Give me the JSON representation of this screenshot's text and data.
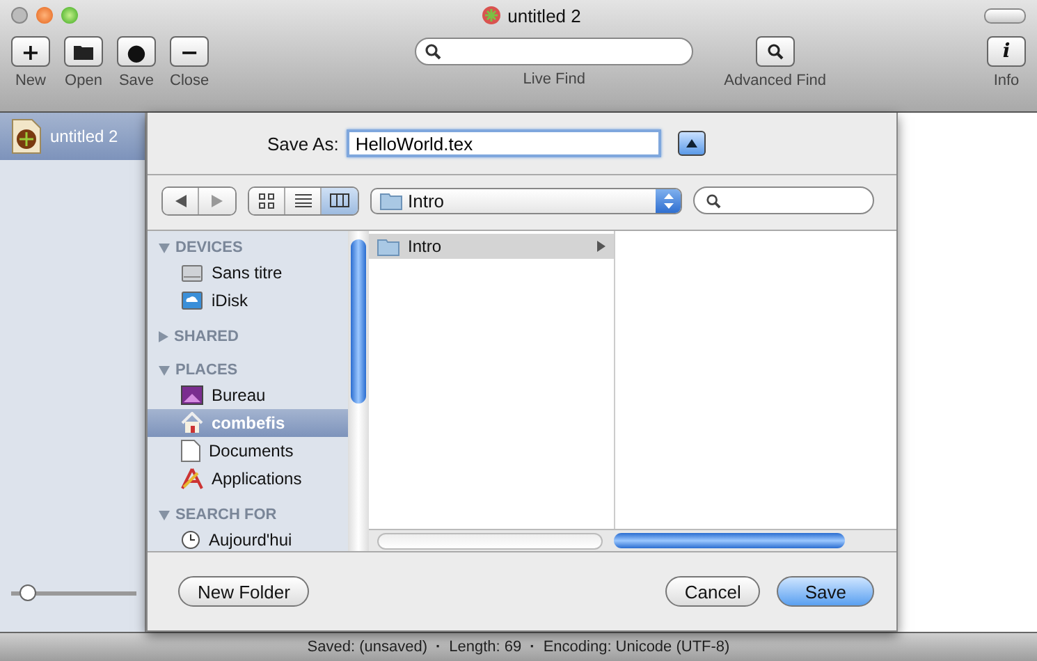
{
  "window": {
    "title": "untitled 2"
  },
  "toolbar": {
    "left": [
      {
        "label": "New",
        "glyph": "+"
      },
      {
        "label": "Open"
      },
      {
        "label": "Save",
        "glyph": "●"
      },
      {
        "label": "Close",
        "glyph": "−"
      }
    ],
    "live_find": {
      "label": "Live Find"
    },
    "advanced_find": {
      "label": "Advanced Find"
    },
    "info": {
      "label": "Info",
      "glyph": "i"
    }
  },
  "documents": [
    {
      "name": "untitled 2",
      "selected": true
    }
  ],
  "zoom_slider": {
    "level": 0.08
  },
  "sheet": {
    "save_as_label": "Save As:",
    "filename": "HelloWorld.tex",
    "location": "Intro",
    "view_modes": [
      {
        "kind": "icons",
        "selected": false
      },
      {
        "kind": "list",
        "selected": false
      },
      {
        "kind": "columns",
        "selected": true
      }
    ],
    "sidebar": [
      {
        "title": "DEVICES",
        "expanded": true,
        "items": [
          {
            "label": "Sans titre",
            "kind": "disk",
            "selected": false
          },
          {
            "label": "iDisk",
            "kind": "idisk",
            "selected": false
          }
        ]
      },
      {
        "title": "SHARED",
        "expanded": false
      },
      {
        "title": "PLACES",
        "expanded": true,
        "items": [
          {
            "label": "Bureau",
            "kind": "desktop",
            "selected": false
          },
          {
            "label": "combefis",
            "kind": "home",
            "selected": true
          },
          {
            "label": "Documents",
            "kind": "doc",
            "selected": false
          },
          {
            "label": "Applications",
            "kind": "apps",
            "selected": false
          }
        ]
      },
      {
        "title": "SEARCH FOR",
        "expanded": true,
        "items": [
          {
            "label": "Aujourd'hui",
            "kind": "clock",
            "selected": false
          }
        ]
      }
    ],
    "columns": [
      [
        {
          "name": "Intro",
          "selected": true
        }
      ]
    ],
    "buttons": {
      "new_folder": "New Folder",
      "cancel": "Cancel",
      "save": "Save"
    }
  },
  "status_bar": {
    "separator": "·",
    "items": [
      "Saved: (unsaved)",
      "Length: 69",
      "Encoding: Unicode (UTF-8)"
    ]
  }
}
